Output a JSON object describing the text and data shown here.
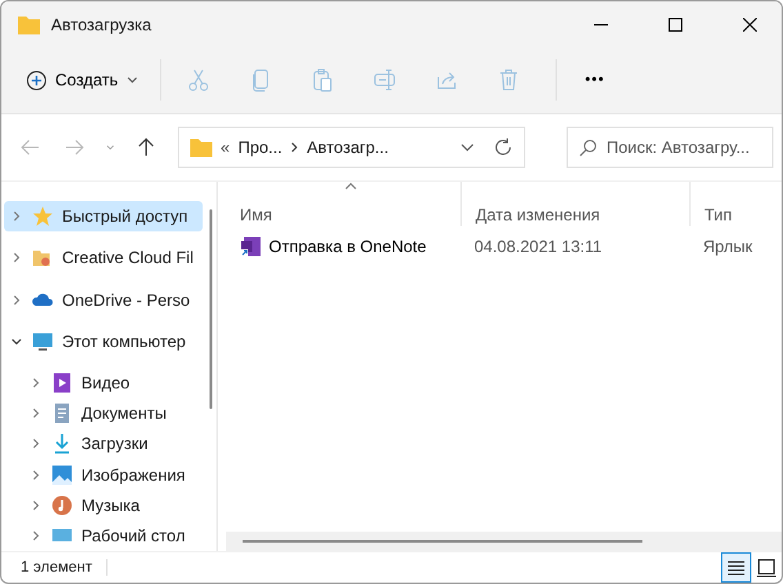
{
  "window": {
    "title": "Автозагрузка"
  },
  "toolbar": {
    "new_button": {
      "label": "Создать"
    },
    "tools": [
      {
        "kind": "cut",
        "disabled": true
      },
      {
        "kind": "copy",
        "disabled": true
      },
      {
        "kind": "paste",
        "disabled": true
      },
      {
        "kind": "rename",
        "disabled": true
      },
      {
        "kind": "share",
        "disabled": true
      },
      {
        "kind": "delete",
        "disabled": true
      }
    ],
    "more": "•••"
  },
  "navigation": {
    "back_disabled": true,
    "forward_disabled": true,
    "up_disabled": false
  },
  "address_bar": {
    "overflow": "«",
    "crumbs": [
      "Про...",
      "Автозагр..."
    ]
  },
  "search": {
    "placeholder": "Поиск: Автозагру..."
  },
  "sidebar": {
    "items": [
      {
        "label": "Быстрый доступ",
        "kind": "star",
        "expanded": false,
        "selected": true
      },
      {
        "label": "Creative Cloud Fil",
        "kind": "cc",
        "expanded": false,
        "selected": false
      },
      {
        "label": "OneDrive - Perso",
        "kind": "cloud",
        "expanded": false,
        "selected": false
      },
      {
        "label": "Этот компьютер",
        "kind": "pc",
        "expanded": true,
        "selected": false,
        "children": [
          {
            "label": "Видео",
            "kind": "video",
            "expanded": false,
            "selected": false
          },
          {
            "label": "Документы",
            "kind": "docs",
            "expanded": false,
            "selected": false
          },
          {
            "label": "Загрузки",
            "kind": "download",
            "expanded": false,
            "selected": false
          },
          {
            "label": "Изображения",
            "kind": "pictures",
            "expanded": false,
            "selected": false
          },
          {
            "label": "Музыка",
            "kind": "music",
            "expanded": false,
            "selected": false
          },
          {
            "label": "Рабочий стол",
            "kind": "desktop",
            "expanded": false,
            "selected": false
          }
        ]
      }
    ]
  },
  "table": {
    "columns": [
      {
        "label": "Имя",
        "sorted": true
      },
      {
        "label": "Дата изменения",
        "sorted": false
      },
      {
        "label": "Тип",
        "sorted": false
      }
    ],
    "rows": [
      {
        "name": "Отправка в OneNote",
        "date": "04.08.2021 13:11",
        "type": "Ярлык",
        "selected": false
      }
    ]
  },
  "status_bar": {
    "count": "1 элемент",
    "views": [
      {
        "kind": "details",
        "selected": true
      },
      {
        "kind": "tiles",
        "selected": false
      }
    ]
  }
}
